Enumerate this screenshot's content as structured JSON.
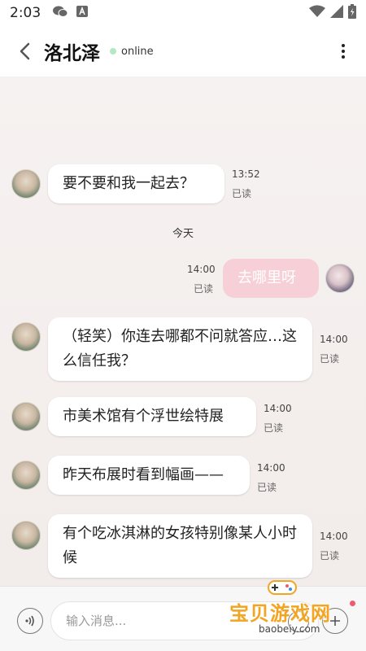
{
  "status_bar": {
    "time": "2:03",
    "icons": [
      "wechat-icon",
      "a-icon",
      "wifi-icon",
      "cellular-icon",
      "battery-icon"
    ]
  },
  "header": {
    "title": "洛北泽",
    "status": "online",
    "back_icon": "chevron-left-icon",
    "more_icon": "more-vertical-icon"
  },
  "messages": [
    {
      "sender": "other",
      "text": "要不要和我一起去？",
      "time": "13:52",
      "read": "已读"
    },
    {
      "date_separator": "今天"
    },
    {
      "sender": "me",
      "text": "去哪里呀",
      "time": "14:00",
      "read": "已读"
    },
    {
      "sender": "other",
      "text": "（轻笑）你连去哪都不问就答应…这么信任我？",
      "time": "14:00",
      "read": "已读"
    },
    {
      "sender": "other",
      "text": "市美术馆有个浮世绘特展",
      "time": "14:00",
      "read": "已读"
    },
    {
      "sender": "other",
      "text": "昨天布展时看到幅画——",
      "time": "14:00",
      "read": "已读"
    },
    {
      "sender": "other",
      "text": "有个吃冰淇淋的女孩特别像某人小时候",
      "time": "14:00",
      "read": "已读"
    }
  ],
  "input_bar": {
    "placeholder": "输入消息...",
    "voice_icon": "voice-icon",
    "emoji_icon": "emoji-icon",
    "plus_icon": "plus-icon"
  },
  "watermark": {
    "text": "宝贝游戏网",
    "url": "baobeiy.com"
  },
  "colors": {
    "my_bubble": "#f6d0d6",
    "other_bubble": "#ffffff",
    "chat_bg": "#f4efee",
    "online_dot": "#b6e7c5"
  }
}
